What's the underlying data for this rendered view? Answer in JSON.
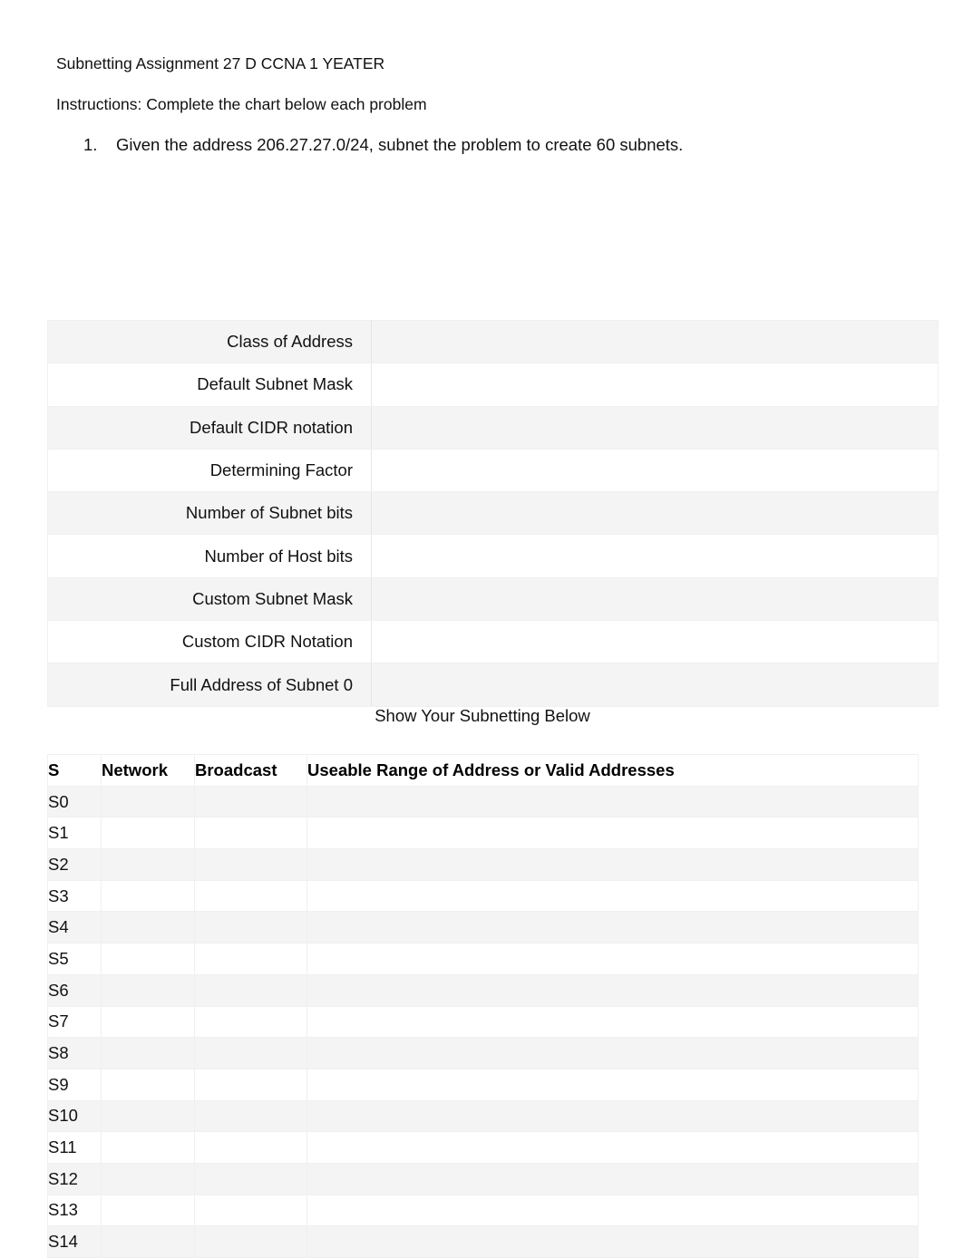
{
  "document": {
    "title": "Subnetting Assignment 27 D CCNA 1 YEATER",
    "instructions": "Instructions: Complete the chart below each problem",
    "problem": {
      "marker": "1.",
      "text": "Given the address 206.27.27.0/24, subnet the problem to create 60 subnets."
    },
    "subnetting_caption": "Show Your Subnetting Below"
  },
  "chart_table": {
    "rows": [
      {
        "label": "Class of Address",
        "value": ""
      },
      {
        "label": "Default Subnet Mask",
        "value": ""
      },
      {
        "label": "Default CIDR notation",
        "value": ""
      },
      {
        "label": "Determining Factor",
        "value": ""
      },
      {
        "label": "Number of Subnet bits",
        "value": ""
      },
      {
        "label": "Number of Host bits",
        "value": ""
      },
      {
        "label": "Custom Subnet Mask",
        "value": ""
      },
      {
        "label": "Custom CIDR Notation",
        "value": ""
      },
      {
        "label": "Full Address of Subnet 0",
        "value": ""
      }
    ]
  },
  "subnet_table": {
    "headers": {
      "subnet": "S",
      "network": "Network",
      "broadcast": "Broadcast",
      "range": "Useable Range of Address or Valid Addresses"
    },
    "rows": [
      {
        "subnet": "S0",
        "network": "",
        "broadcast": "",
        "range": ""
      },
      {
        "subnet": "S1",
        "network": "",
        "broadcast": "",
        "range": ""
      },
      {
        "subnet": "S2",
        "network": "",
        "broadcast": "",
        "range": ""
      },
      {
        "subnet": "S3",
        "network": "",
        "broadcast": "",
        "range": ""
      },
      {
        "subnet": "S4",
        "network": "",
        "broadcast": "",
        "range": ""
      },
      {
        "subnet": "S5",
        "network": "",
        "broadcast": "",
        "range": ""
      },
      {
        "subnet": "S6",
        "network": "",
        "broadcast": "",
        "range": ""
      },
      {
        "subnet": "S7",
        "network": "",
        "broadcast": "",
        "range": ""
      },
      {
        "subnet": "S8",
        "network": "",
        "broadcast": "",
        "range": ""
      },
      {
        "subnet": "S9",
        "network": "",
        "broadcast": "",
        "range": ""
      },
      {
        "subnet": "S10",
        "network": "",
        "broadcast": "",
        "range": ""
      },
      {
        "subnet": "S11",
        "network": "",
        "broadcast": "",
        "range": ""
      },
      {
        "subnet": "S12",
        "network": "",
        "broadcast": "",
        "range": ""
      },
      {
        "subnet": "S13",
        "network": "",
        "broadcast": "",
        "range": ""
      },
      {
        "subnet": "S14",
        "network": "",
        "broadcast": "",
        "range": ""
      }
    ]
  },
  "colors": {
    "page_background": "#ffffff",
    "text": "#111111",
    "table_band": "#f4f4f4",
    "table_border": "#f0f0f0"
  }
}
